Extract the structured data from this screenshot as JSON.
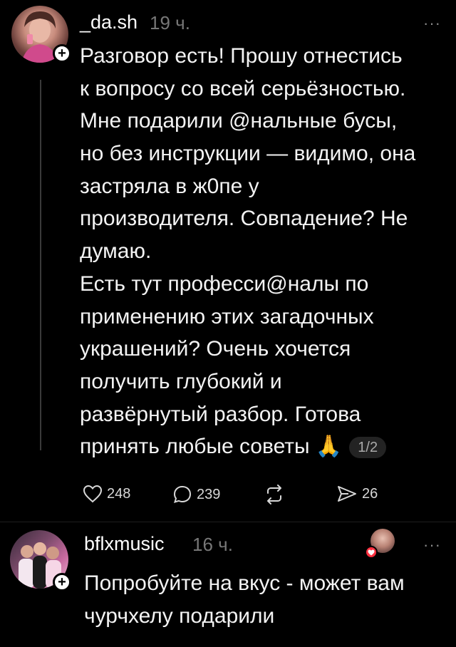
{
  "post1": {
    "username": "_da.sh",
    "time": "19 ч.",
    "more": "···",
    "lines": [
      "Разговор есть! Прошу отнестись",
      "к вопросу со всей серьёзностью.",
      "Мне подарили @нальные бусы,",
      "но без инструкции — видимо, она",
      "застряла в ж0пе у",
      "производителя. Совпадение? Не",
      "думаю.",
      "Есть тут професси@налы по",
      "применению этих загадочных",
      "украшений? Очень хочется",
      "получить глубокий и",
      "развёрнутый разбор. Готова",
      "принять любые советы 🙏"
    ],
    "pager": "1/2",
    "likes": "248",
    "comments": "239",
    "shares": "26"
  },
  "post2": {
    "username": "bflxmusic",
    "time": "16 ч.",
    "more": "···",
    "lines": [
      "Попробуйте на вкус - может вам",
      "чурчхелу подарили"
    ]
  }
}
